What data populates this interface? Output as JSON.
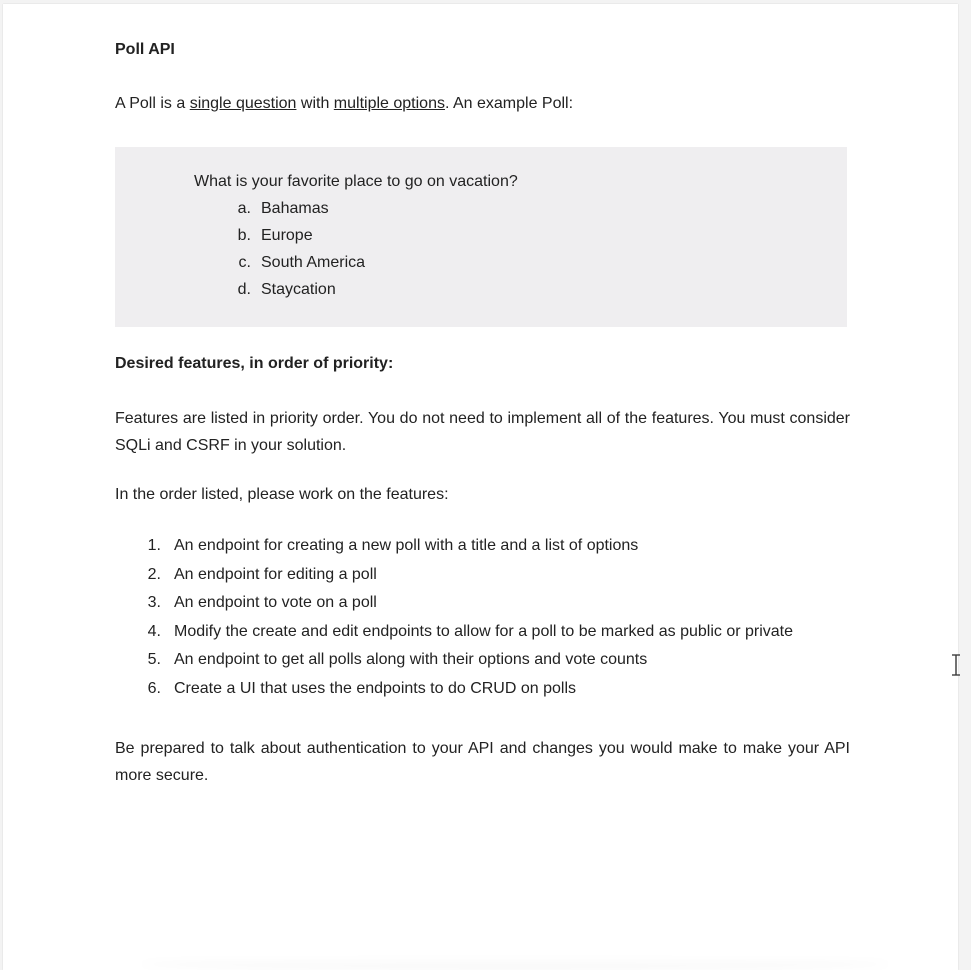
{
  "document": {
    "title": "Poll API",
    "intro": {
      "prefix": "A Poll is a ",
      "link1": "single question",
      "middle": " with ",
      "link2": "multiple options",
      "suffix": ". An example Poll:"
    },
    "example": {
      "question": "What is your favorite place to go on vacation?",
      "options": [
        {
          "letter": "a.",
          "text": "Bahamas"
        },
        {
          "letter": "b.",
          "text": "Europe"
        },
        {
          "letter": "c.",
          "text": "South America"
        },
        {
          "letter": "d.",
          "text": "Staycation"
        }
      ]
    },
    "features_heading": "Desired features, in order of priority:",
    "features_paragraph": "Features are listed in priority order. You do not need to implement all of the features. You must consider SQLi and CSRF in your solution.",
    "order_paragraph": "In the order listed, please work on the features:",
    "features": [
      {
        "num": "1.",
        "text": "An endpoint for creating a new poll with a title and a list of options"
      },
      {
        "num": "2.",
        "text": "An endpoint for editing a poll"
      },
      {
        "num": "3.",
        "text": "An endpoint to vote on a poll"
      },
      {
        "num": "4.",
        "text": "Modify the create and edit endpoints to allow for a poll to be marked as public or private"
      },
      {
        "num": "5.",
        "text": "An endpoint to get all polls along with their options and vote counts"
      },
      {
        "num": "6.",
        "text": "Create a UI that uses the endpoints to do CRUD on polls"
      }
    ],
    "closing_paragraph": "Be prepared to talk about authentication to your API and changes you would make to make your API more secure."
  },
  "colors": {
    "example_box_bg": "#efeef0",
    "page_bg": "#ffffff",
    "text": "#222222"
  },
  "icons": {
    "cursor": "text-cursor-icon"
  }
}
